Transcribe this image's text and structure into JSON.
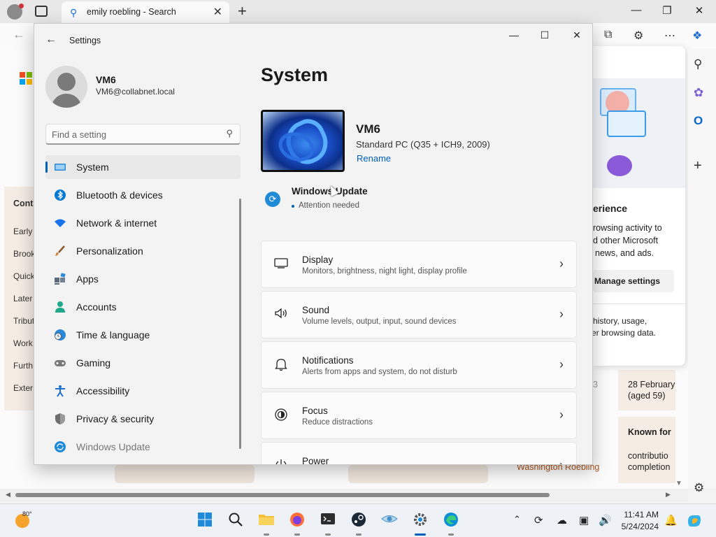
{
  "browser": {
    "tab_title": "emily roebling - Search",
    "tab_close": "✕",
    "new_tab": "+"
  },
  "webpage": {
    "sidebar": {
      "heading": "Conte",
      "items": [
        "Early",
        "Brook",
        "Quick",
        "Later",
        "Tribut",
        "Work",
        "Furth",
        "Exter"
      ]
    },
    "fact_death": [
      "28 February",
      "(aged 59)"
    ],
    "known_for_label": "Known for",
    "known_for_text": [
      "contributio",
      "completion"
    ],
    "spouse_link": "Washington Roebling",
    "death_number": "3"
  },
  "popup": {
    "heading": "erience",
    "body": [
      "rowsing activity to",
      "d other Microsoft",
      "news, and ads."
    ],
    "button_label": "Manage settings",
    "footer": [
      "history, usage,",
      "er browsing data."
    ]
  },
  "settings": {
    "window_title": "Settings",
    "user": {
      "name": "VM6",
      "email": "VM6@collabnet.local"
    },
    "search": {
      "placeholder": "Find a setting"
    },
    "nav": [
      {
        "label": "System",
        "icon": "monitor-icon",
        "color": "#2b88d8"
      },
      {
        "label": "Bluetooth & devices",
        "icon": "bluetooth-icon",
        "color": "#0078d4"
      },
      {
        "label": "Network & internet",
        "icon": "wifi-icon",
        "color": "#1a73e8"
      },
      {
        "label": "Personalization",
        "icon": "brush-icon",
        "color": "#d08a4a"
      },
      {
        "label": "Apps",
        "icon": "apps-icon",
        "color": "#5b6b7c"
      },
      {
        "label": "Accounts",
        "icon": "person-icon",
        "color": "#1fa88a"
      },
      {
        "label": "Time & language",
        "icon": "globe-clock-icon",
        "color": "#2b88d8"
      },
      {
        "label": "Gaming",
        "icon": "gamepad-icon",
        "color": "#7a7a7a"
      },
      {
        "label": "Accessibility",
        "icon": "accessibility-icon",
        "color": "#1b6fd1"
      },
      {
        "label": "Privacy & security",
        "icon": "shield-icon",
        "color": "#6d6d6d"
      },
      {
        "label": "Windows Update",
        "icon": "update-icon",
        "color": "#1f8ad8"
      }
    ],
    "page_title": "System",
    "device": {
      "name": "VM6",
      "model": "Standard PC (Q35 + ICH9, 2009)",
      "rename_label": "Rename"
    },
    "windows_update": {
      "title": "Windows Update",
      "status": "Attention needed"
    },
    "cards": [
      {
        "title": "Display",
        "subtitle": "Monitors, brightness, night light, display profile",
        "icon": "display-icon"
      },
      {
        "title": "Sound",
        "subtitle": "Volume levels, output, input, sound devices",
        "icon": "speaker-icon"
      },
      {
        "title": "Notifications",
        "subtitle": "Alerts from apps and system, do not disturb",
        "icon": "bell-icon"
      },
      {
        "title": "Focus",
        "subtitle": "Reduce distractions",
        "icon": "focus-icon"
      },
      {
        "title": "Power",
        "subtitle": "",
        "icon": "power-icon"
      }
    ]
  },
  "taskbar": {
    "weather_temp": "80°",
    "time": "11:41 AM",
    "date": "5/24/2024"
  }
}
